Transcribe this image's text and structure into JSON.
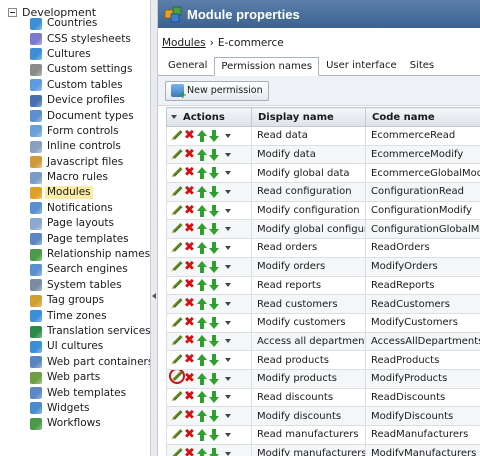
{
  "tree": {
    "root_label": "Development",
    "items": [
      {
        "label": "Countries",
        "icon": "globe-icon",
        "color": "#3c8fd6"
      },
      {
        "label": "CSS stylesheets",
        "icon": "css-icon",
        "color": "#7a7ad0"
      },
      {
        "label": "Cultures",
        "icon": "globe-icon",
        "color": "#3c8fd6"
      },
      {
        "label": "Custom settings",
        "icon": "wrench-icon",
        "color": "#8a8a8a"
      },
      {
        "label": "Custom tables",
        "icon": "table-icon",
        "color": "#5d9be0"
      },
      {
        "label": "Device profiles",
        "icon": "device-icon",
        "color": "#4a6fb0"
      },
      {
        "label": "Document types",
        "icon": "document-icon",
        "color": "#5c8fd0"
      },
      {
        "label": "Form controls",
        "icon": "form-icon",
        "color": "#6aa0d8"
      },
      {
        "label": "Inline controls",
        "icon": "inline-icon",
        "color": "#8aa0c0"
      },
      {
        "label": "Javascript files",
        "icon": "script-icon",
        "color": "#d09a3a"
      },
      {
        "label": "Macro rules",
        "icon": "macro-icon",
        "color": "#7a9ac8"
      },
      {
        "label": "Modules",
        "icon": "modules-icon",
        "color": "#e0a020",
        "selected": true
      },
      {
        "label": "Notifications",
        "icon": "notification-icon",
        "color": "#5a8fd0"
      },
      {
        "label": "Page layouts",
        "icon": "layout-icon",
        "color": "#8aa8d0"
      },
      {
        "label": "Page templates",
        "icon": "template-icon",
        "color": "#5d86c4"
      },
      {
        "label": "Relationship names",
        "icon": "relationship-icon",
        "color": "#4a9a4a"
      },
      {
        "label": "Search engines",
        "icon": "search-icon",
        "color": "#5a8fd0"
      },
      {
        "label": "System tables",
        "icon": "table-icon",
        "color": "#7a8aa0"
      },
      {
        "label": "Tag groups",
        "icon": "tag-icon",
        "color": "#d0a030"
      },
      {
        "label": "Time zones",
        "icon": "clock-icon",
        "color": "#3a8fd6"
      },
      {
        "label": "Translation services",
        "icon": "translation-icon",
        "color": "#2a8a4a"
      },
      {
        "label": "UI cultures",
        "icon": "globe-icon",
        "color": "#3c8fd6"
      },
      {
        "label": "Web part containers",
        "icon": "container-icon",
        "color": "#5a86c0"
      },
      {
        "label": "Web parts",
        "icon": "webpart-icon",
        "color": "#6aa040"
      },
      {
        "label": "Web templates",
        "icon": "template-icon",
        "color": "#5d86c4"
      },
      {
        "label": "Widgets",
        "icon": "widget-icon",
        "color": "#4a8ad0"
      },
      {
        "label": "Workflows",
        "icon": "workflow-icon",
        "color": "#4a9a4a"
      }
    ]
  },
  "header": {
    "title": "Module properties",
    "accent": "#3c6291"
  },
  "breadcrumb": {
    "link": "Modules",
    "current": "E-commerce"
  },
  "tabs": [
    {
      "label": "General",
      "active": false
    },
    {
      "label": "Permission names",
      "active": true
    },
    {
      "label": "User interface",
      "active": false
    },
    {
      "label": "Sites",
      "active": false
    }
  ],
  "toolbar": {
    "new_permission_label": "New permission"
  },
  "grid": {
    "columns": [
      "Actions",
      "Display name",
      "Code name"
    ],
    "rows": [
      {
        "display": "Read data",
        "code": "EcommerceRead"
      },
      {
        "display": "Modify data",
        "code": "EcommerceModify"
      },
      {
        "display": "Modify global data",
        "code": "EcommerceGlobalModify"
      },
      {
        "display": "Read configuration",
        "code": "ConfigurationRead"
      },
      {
        "display": "Modify configuration",
        "code": "ConfigurationModify"
      },
      {
        "display": "Modify global configuration",
        "code": "ConfigurationGlobalModify"
      },
      {
        "display": "Read orders",
        "code": "ReadOrders"
      },
      {
        "display": "Modify orders",
        "code": "ModifyOrders"
      },
      {
        "display": "Read reports",
        "code": "ReadReports"
      },
      {
        "display": "Read customers",
        "code": "ReadCustomers"
      },
      {
        "display": "Modify customers",
        "code": "ModifyCustomers"
      },
      {
        "display": "Access all departments",
        "code": "AccessAllDepartments"
      },
      {
        "display": "Read products",
        "code": "ReadProducts"
      },
      {
        "display": "Modify products",
        "code": "ModifyProducts",
        "highlighted": true
      },
      {
        "display": "Read discounts",
        "code": "ReadDiscounts"
      },
      {
        "display": "Modify discounts",
        "code": "ModifyDiscounts"
      },
      {
        "display": "Read manufacturers",
        "code": "ReadManufacturers"
      },
      {
        "display": "Modify manufacturers",
        "code": "ModifyManufacturers"
      }
    ]
  }
}
